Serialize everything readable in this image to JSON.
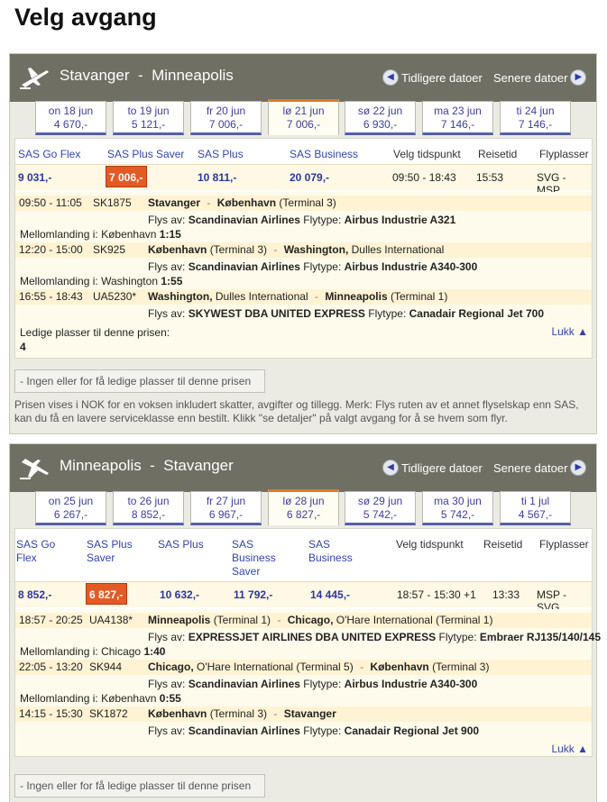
{
  "page_title": "Velg avgang",
  "nav": {
    "prev": "Tidligere datoer",
    "next": "Senere datoer"
  },
  "outbound": {
    "route_from": "Stavanger",
    "route_to": "Minneapolis",
    "dates": [
      {
        "day": "on 18 jun",
        "price": "4 670,-"
      },
      {
        "day": "to 19 jun",
        "price": "5 121,-"
      },
      {
        "day": "fr 20 jun",
        "price": "7 006,-"
      },
      {
        "day": "lø 21 jun",
        "price": "7 006,-"
      },
      {
        "day": "sø 22 jun",
        "price": "6 930,-"
      },
      {
        "day": "ma 23 jun",
        "price": "7 146,-"
      },
      {
        "day": "ti 24 jun",
        "price": "7 146,-"
      }
    ],
    "headers": {
      "go_flex": "SAS Go Flex",
      "plus_saver": "SAS Plus Saver",
      "plus": "SAS Plus",
      "business": "SAS Business",
      "time": "Velg tidspunkt",
      "duration": "Reisetid",
      "airports": "Flyplasser"
    },
    "prices": {
      "go_flex": "9 031,-",
      "plus_saver": "7 006,-",
      "plus": "10 811,-",
      "business": "20 079,-"
    },
    "time": "09:50 - 18:43",
    "duration": "15:53",
    "airports": "SVG - MSP",
    "segments": [
      {
        "times": "09:50 - 11:05",
        "flight": "SK1875",
        "from": "Stavanger",
        "from_extra": "",
        "to": "København",
        "to_extra": "(Terminal 3)",
        "operator": "Scandinavian Airlines",
        "aircraft": "Airbus Industrie A321"
      },
      {
        "times": "12:20 - 15:00",
        "flight": "SK925",
        "from": "København",
        "from_extra": "(Terminal 3)",
        "to": "Washington,",
        "to_extra": "Dulles International",
        "operator": "Scandinavian Airlines",
        "aircraft": "Airbus Industrie A340-300"
      },
      {
        "times": "16:55 - 18:43",
        "flight": "UA5230*",
        "from": "Washington,",
        "from_extra": "Dulles International",
        "to": "Minneapolis",
        "to_extra": "(Terminal 1)",
        "operator": "SKYWEST DBA UNITED EXPRESS",
        "aircraft": "Canadair Regional Jet 700"
      }
    ],
    "stopovers": [
      {
        "place": "København",
        "time": "1:15"
      },
      {
        "place": "Washington",
        "time": "1:55"
      }
    ],
    "seats_label": "Ledige plasser til denne prisen:",
    "seats_value": "4",
    "close": "Lukk ▲",
    "no_seats_button": "- Ingen eller for få ledige plasser til denne prisen",
    "note": "Prisen vises i NOK for en voksen inkludert skatter, avgifter og tillegg. Merk: Flys ruten av et annet flyselskap enn SAS, kan du få en lavere serviceklasse enn bestilt. Klikk \"se detaljer\" på valgt avgang for å se hvem som flyr."
  },
  "inbound": {
    "route_from": "Minneapolis",
    "route_to": "Stavanger",
    "dates": [
      {
        "day": "on 25 jun",
        "price": "6 267,-"
      },
      {
        "day": "to 26 jun",
        "price": "8 852,-"
      },
      {
        "day": "fr 27 jun",
        "price": "6 967,-"
      },
      {
        "day": "lø 28 jun",
        "price": "6 827,-"
      },
      {
        "day": "sø 29 jun",
        "price": "5 742,-"
      },
      {
        "day": "ma 30 jun",
        "price": "5 742,-"
      },
      {
        "day": "ti 1 jul",
        "price": "4 567,-"
      }
    ],
    "headers": {
      "go_flex_1": "SAS Go",
      "go_flex_2": "Flex",
      "plus_saver_1": "SAS Plus",
      "plus_saver_2": "Saver",
      "plus": "SAS Plus",
      "bus_saver_1": "SAS",
      "bus_saver_2": "Business",
      "bus_saver_3": "Saver",
      "business_1": "SAS",
      "business_2": "Business",
      "time": "Velg tidspunkt",
      "duration": "Reisetid",
      "airports": "Flyplasser"
    },
    "prices": {
      "go_flex": "8 852,-",
      "plus_saver": "6 827,-",
      "plus": "10 632,-",
      "business_saver": "11 792,-",
      "business": "14 445,-"
    },
    "time": "18:57 - 15:30",
    "day_offset": "+1",
    "duration": "13:33",
    "airports": "MSP - SVG",
    "segments": [
      {
        "times": "18:57 - 20:25",
        "flight": "UA4138*",
        "from": "Minneapolis",
        "from_extra": "(Terminal 1)",
        "to": "Chicago,",
        "to_extra": "O'Hare International (Terminal 1)",
        "operator": "EXPRESSJET AIRLINES DBA UNITED EXPRESS",
        "aircraft": "Embraer RJ135/140/145"
      },
      {
        "times": "22:05 - 13:20",
        "flight": "SK944",
        "from": "Chicago,",
        "from_extra": "O'Hare International (Terminal 5)",
        "to": "København",
        "to_extra": "(Terminal 3)",
        "operator": "Scandinavian Airlines",
        "aircraft": "Airbus Industrie A340-300"
      },
      {
        "times": "14:15 - 15:30",
        "flight": "SK1872",
        "from": "København",
        "from_extra": "(Terminal 3)",
        "to": "Stavanger",
        "to_extra": "",
        "operator": "Scandinavian Airlines",
        "aircraft": "Canadair Regional Jet 900"
      }
    ],
    "stopovers": [
      {
        "place": "Chicago",
        "time": "1:40"
      },
      {
        "place": "København",
        "time": "0:55"
      }
    ],
    "close": "Lukk ▲",
    "no_seats_button": "- Ingen eller for få ledige plasser til denne prisen"
  },
  "labels": {
    "operated_by": "Flys av:",
    "aircraft": "Flytype:",
    "stopover": "Mellomlanding i:",
    "dash": "-"
  },
  "colors": {
    "header_bg": "#6f6f64",
    "accent": "#e25b25",
    "link": "#3344aa"
  }
}
